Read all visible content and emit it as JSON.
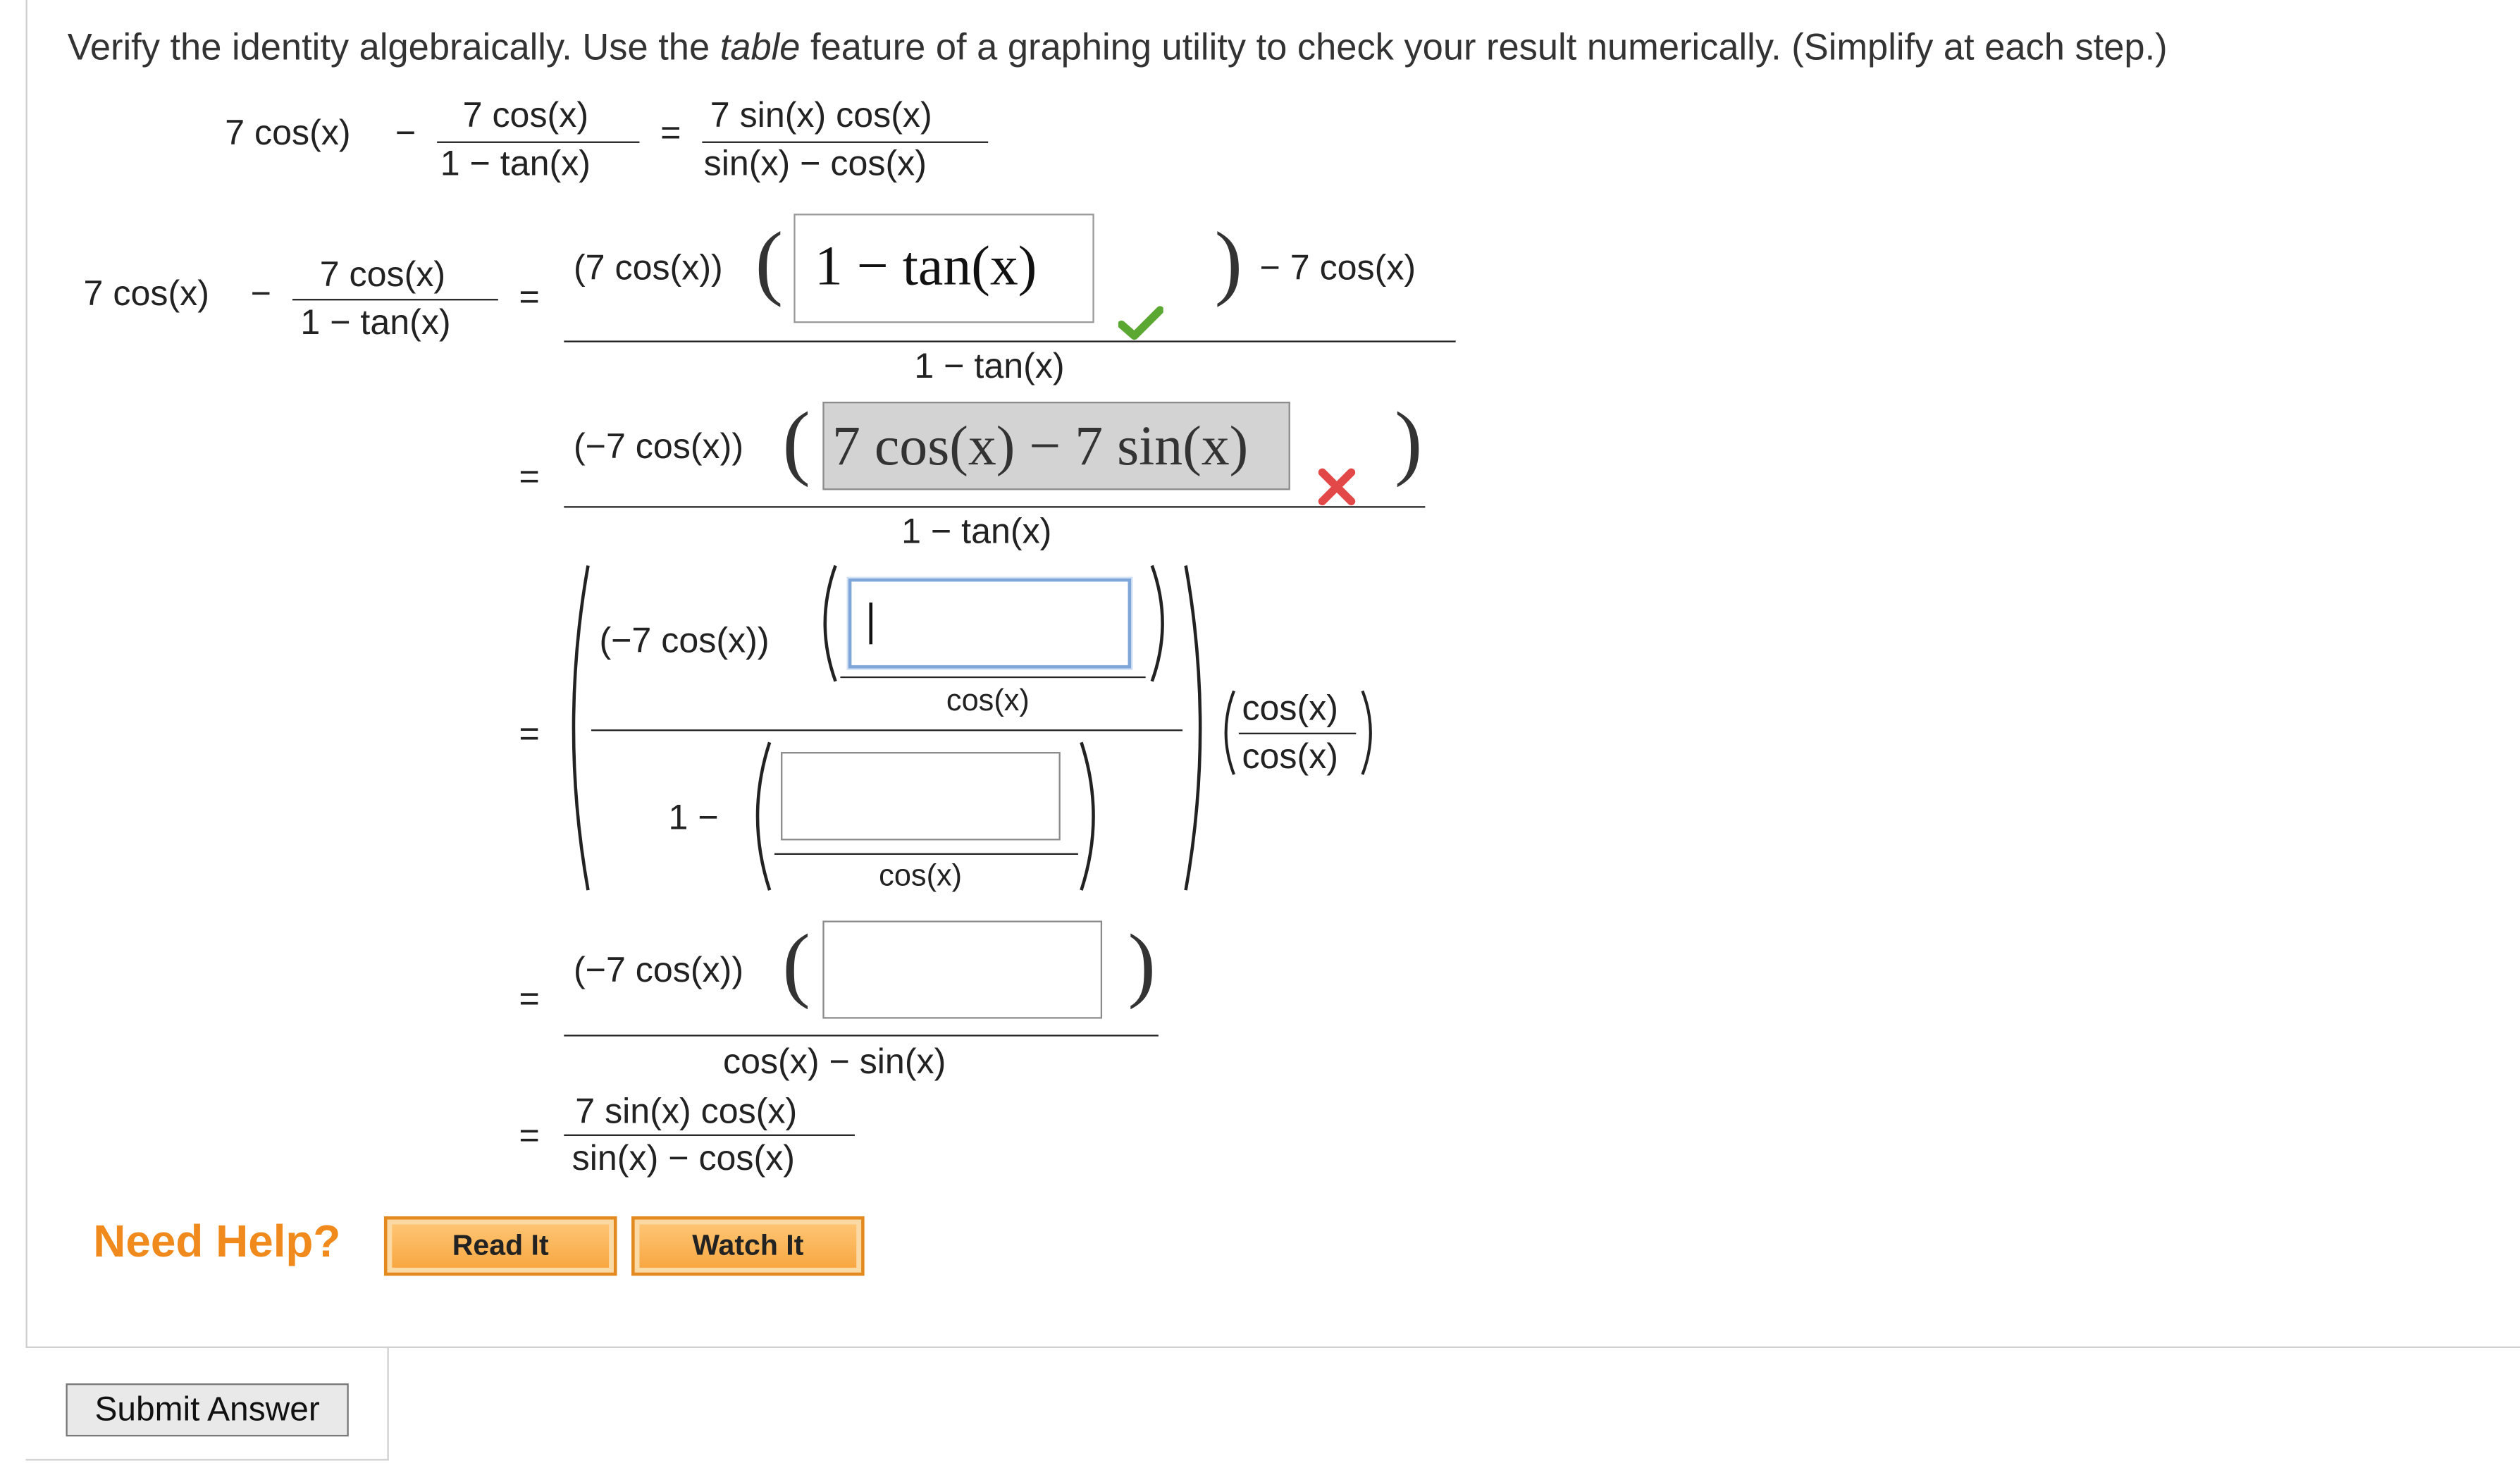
{
  "instructions": {
    "part1": "Verify the identity algebraically. Use the ",
    "emph": "table",
    "part2": " feature of a graphing utility to check your result numerically. (Simplify at each step.)"
  },
  "identity": {
    "lhs_term": "7 cos(x)",
    "minus": "−",
    "lhs_frac_num": "7 cos(x)",
    "lhs_frac_den": "1 − tan(x)",
    "equals": "=",
    "rhs_num": "7 sin(x) cos(x)",
    "rhs_den": "sin(x) − cos(x)"
  },
  "steps": {
    "start_lhs_term": "7 cos(x)",
    "start_frac_num": "7 cos(x)",
    "start_frac_den": "1 − tan(x)",
    "step1": {
      "prefix": "(7 cos(x))",
      "answer": "1 − tan(x)",
      "suffix": "− 7 cos(x)",
      "denominator": "1 − tan(x)",
      "status": "correct"
    },
    "step2": {
      "prefix": "(−7 cos(x))",
      "answer": "7 cos(x) − 7 sin(x)",
      "denominator": "1 − tan(x)",
      "status": "incorrect"
    },
    "step3": {
      "prefix": "(−7 cos(x))",
      "inner_den_top": "cos(x)",
      "one_minus": "1 −",
      "inner_den_bottom": "cos(x)",
      "mult_num": "cos(x)",
      "mult_den": "cos(x)",
      "input_top_value": "",
      "input_bottom_value": ""
    },
    "step4": {
      "prefix": "(−7 cos(x))",
      "denominator": "cos(x) − sin(x)",
      "input_value": ""
    },
    "step5": {
      "num": "7 sin(x) cos(x)",
      "den": "sin(x) − cos(x)"
    }
  },
  "help": {
    "label": "Need Help?",
    "read_button": "Read It",
    "watch_button": "Watch It"
  },
  "submit_button": "Submit Answer",
  "colors": {
    "help_label": "#f08a1c",
    "check": "#5aa832",
    "cross": "#e34848",
    "active_border": "#7ea6d8"
  }
}
